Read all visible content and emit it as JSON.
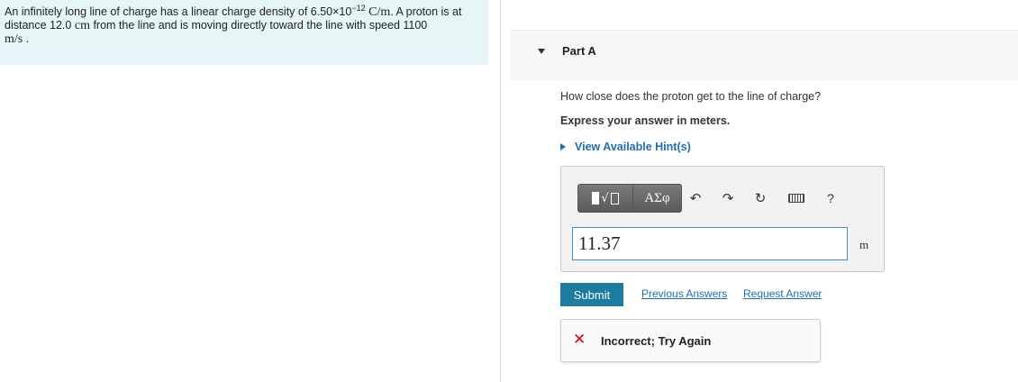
{
  "problem": {
    "t1": "An infinitely long line of charge has a linear charge density of ",
    "density_value": "6.50×10",
    "density_exp": "−12",
    "density_unit": "C/m",
    "t2": ". A proton is at distance ",
    "distance": "12.0",
    "distance_unit": "cm",
    "t3": " from the line and is moving directly toward the line with speed ",
    "speed": "1100",
    "speed_unit": "m/s",
    "t4": "."
  },
  "part": {
    "label": "Part A"
  },
  "question": "How close does the proton get to the line of charge?",
  "instruction": "Express your answer in meters.",
  "hint_link": "View Available Hint(s)",
  "toolbar": {
    "templates_icon": "templates-icon",
    "greek_label": "ΑΣφ",
    "undo_icon": "undo-icon",
    "redo_icon": "redo-icon",
    "reset_icon": "reset-icon",
    "keyboard_icon": "keyboard-icon",
    "help_label": "?"
  },
  "answer": {
    "value": "11.37",
    "unit": "m"
  },
  "actions": {
    "submit": "Submit",
    "previous_answers": "Previous Answers",
    "request_answer": "Request Answer"
  },
  "feedback": {
    "icon": "incorrect-x-icon",
    "text": "Incorrect; Try Again"
  },
  "colors": {
    "problem_bg": "#e6f5f5",
    "link": "#1f6db5",
    "submit_bg": "#1c7b9f",
    "input_border": "#3a8fc9",
    "error": "#d0021b"
  }
}
